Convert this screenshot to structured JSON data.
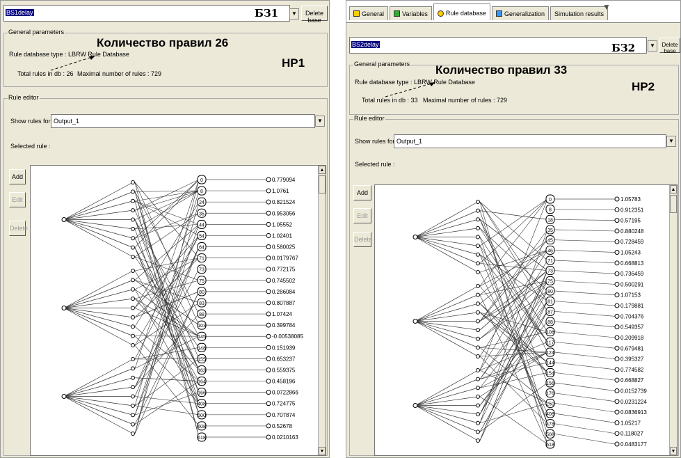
{
  "left": {
    "db_name": "BS1delay",
    "db_label": "БЗ1",
    "delete_base": "Delete base",
    "general_parameters": "General parameters",
    "rule_db_type": "Rule database type : LBRW Rule Database",
    "total_rules": "Total rules in db : 26",
    "max_rules": "Maximal number of rules : 729",
    "rule_count_annotation": "Количество правил 26",
    "hp_label": "НР1",
    "rule_editor": "Rule editor",
    "show_rules_label": "Show rules for output :",
    "output_value": "Output_1",
    "selected_rule": "Selected rule :",
    "add": "Add",
    "edit": "Edit",
    "delete": "Delete",
    "rule_ids": [
      "0",
      "8",
      "24",
      "35",
      "44",
      "54",
      "64",
      "71",
      "73",
      "75",
      "80",
      "83",
      "88",
      "103",
      "145",
      "148",
      "155",
      "163",
      "164",
      "166",
      "408",
      "500",
      "608",
      "618"
    ],
    "outputs": [
      "0.779094",
      "1.0761",
      "0.821524",
      "0.953056",
      "1.05552",
      "1.02401",
      "0.580025",
      "0.0179767",
      "0.772175",
      "0.745502",
      "0.286084",
      "0.807887",
      "1.07424",
      "0.399784",
      "-0.00538085",
      "0.151939",
      "0.653237",
      "0.559375",
      "0.458196",
      "0.0722866",
      "0.724775",
      "0.707874",
      "0.52678",
      "0.0210163"
    ]
  },
  "right": {
    "tabs": [
      "General",
      "Variables",
      "Rule database",
      "Generalization",
      "Simulation results"
    ],
    "active_tab": "Rule database",
    "db_name": "BS2delay",
    "db_label": "БЗ2",
    "delete_base": "Delete base",
    "general_parameters": "General parameters",
    "rule_db_type": "Rule database type : LBRW Rule Database",
    "total_rules": "Total rules in db : 33",
    "max_rules": "Maximal number of rules : 729",
    "rule_count_annotation": "Количество правил 33",
    "hp_label": "НР2",
    "rule_editor": "Rule editor",
    "show_rules_label": "Show rules for output :",
    "output_value": "Output_1",
    "selected_rule": "Selected rule :",
    "add": "Add",
    "edit": "Edit",
    "delete": "Delete",
    "rule_ids": [
      "0",
      "8",
      "18",
      "35",
      "45",
      "46",
      "71",
      "73",
      "75",
      "80",
      "81",
      "87",
      "88",
      "108",
      "117",
      "124",
      "144",
      "154",
      "156",
      "176",
      "250",
      "408",
      "478",
      "508",
      "618"
    ],
    "outputs": [
      "1.05783",
      "0.912351",
      "0.57195",
      "0.880248",
      "0.728459",
      "1.05243",
      "0.668813",
      "0.736459",
      "0.500291",
      "1.07153",
      "0.179881",
      "0.704376",
      "0.549357",
      "0.209918",
      "0.679481",
      "0.395327",
      "0.774582",
      "0.668827",
      "0.0152739",
      "0.0231224",
      "0.0836913",
      "1.05217",
      "0.118027",
      "0.0483177"
    ]
  }
}
